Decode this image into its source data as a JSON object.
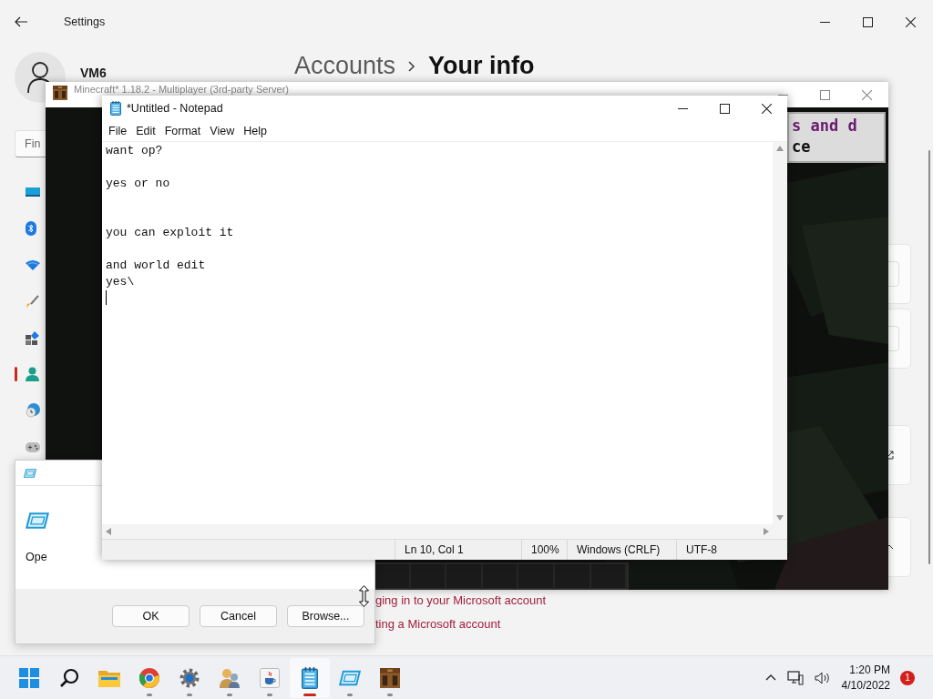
{
  "settings": {
    "title": "Settings",
    "user": "VM6",
    "breadcrumb": [
      {
        "label": "Accounts",
        "current": false
      },
      {
        "label": "Your info",
        "current": true
      }
    ],
    "search": {
      "placeholder": "Fin"
    },
    "nav": [
      {
        "selected": false
      },
      {
        "selected": false
      },
      {
        "selected": false
      },
      {
        "selected": false
      },
      {
        "selected": false
      },
      {
        "selected": true
      },
      {
        "selected": false
      },
      {
        "selected": false
      }
    ],
    "links": [
      "ging in to your Microsoft account",
      "ting a Microsoft account"
    ]
  },
  "minecraft": {
    "title": "Minecraft* 1.18.2 - Multiplayer (3rd-party Server)",
    "chat_lines": [
      {
        "text": "s and d",
        "color": "#6a1b6e"
      },
      {
        "text": "ce",
        "color": "#111111"
      }
    ]
  },
  "run_dialog": {
    "open_label": "Ope",
    "buttons": [
      "OK",
      "Cancel",
      "Browse..."
    ]
  },
  "notepad": {
    "title": "*Untitled - Notepad",
    "menu": [
      "File",
      "Edit",
      "Format",
      "View",
      "Help"
    ],
    "text": "want op?\n\nyes or no\n\n\nyou can exploit it\n\nand world edit\nyes\\\n",
    "status": [
      "Ln 10, Col 1",
      "100%",
      "Windows (CRLF)",
      "UTF-8"
    ]
  },
  "taskbar": {
    "apps": [
      {
        "running": false,
        "active": false
      },
      {
        "running": false,
        "active": false
      },
      {
        "running": false,
        "active": false
      },
      {
        "running": true,
        "active": false
      },
      {
        "running": true,
        "active": false
      },
      {
        "running": true,
        "active": false
      },
      {
        "running": true,
        "active": false
      },
      {
        "running": true,
        "active": true
      },
      {
        "running": true,
        "active": false
      },
      {
        "running": true,
        "active": false
      }
    ],
    "time": "1:20 PM",
    "date": "4/10/2022",
    "notification_count": "1"
  }
}
